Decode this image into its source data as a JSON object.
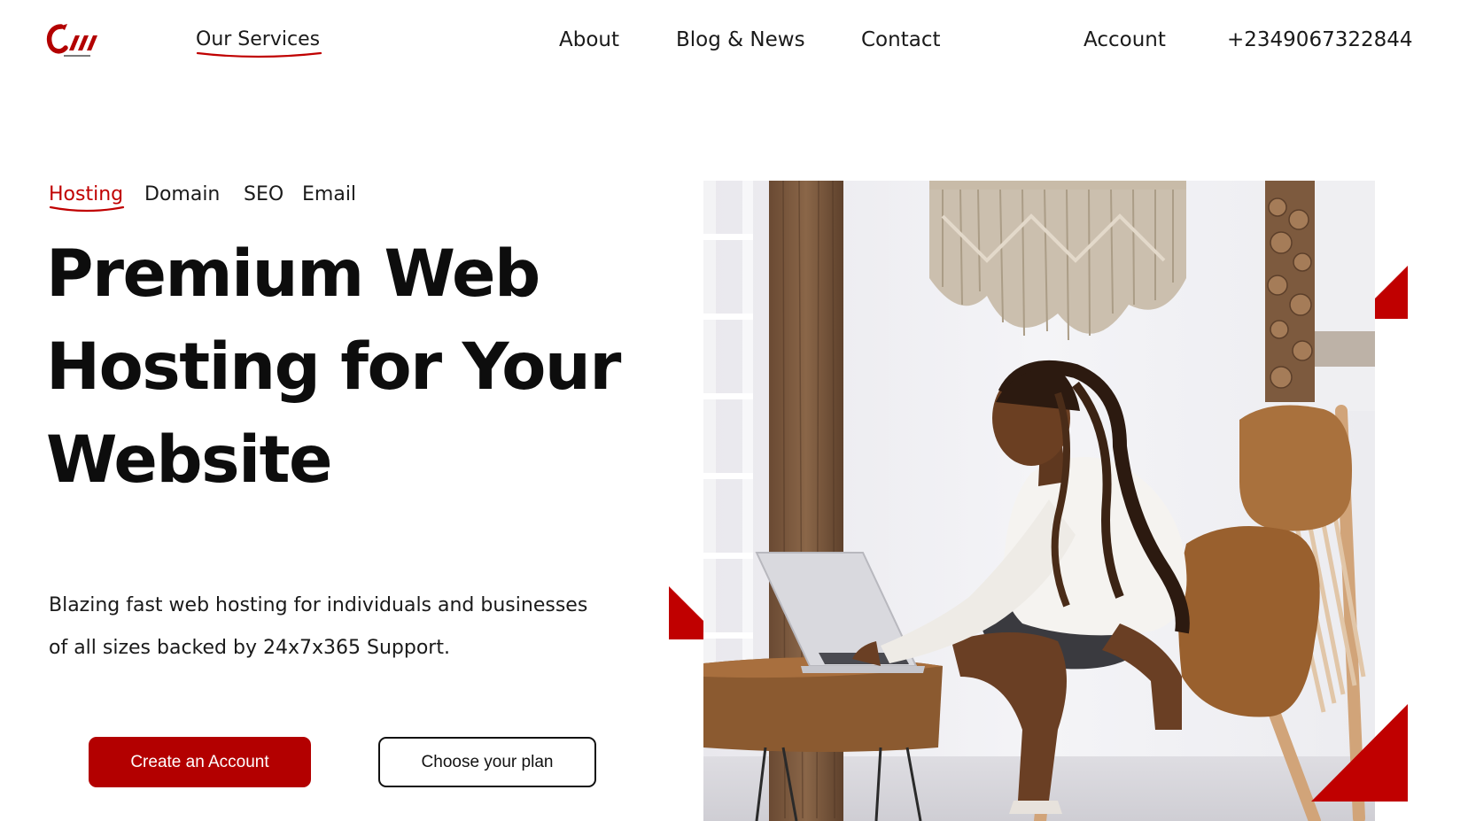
{
  "header": {
    "logo_icon": "brand-logo-icon",
    "nav": {
      "services": "Our Services",
      "about": "About",
      "blog": "Blog & News",
      "contact": "Contact",
      "account": "Account",
      "phone": "+2349067322844"
    }
  },
  "tabs": {
    "items": [
      "Hosting",
      "Domain",
      "SEO",
      "Email"
    ],
    "active": "Hosting"
  },
  "hero": {
    "title_lines": [
      "Premium Web",
      "Hosting for Your",
      "Website"
    ],
    "description_lines": [
      "Blazing fast web hosting for individuals and businesses",
      "of all sizes backed by 24x7x365 Support."
    ],
    "primary_button": "Create an Account",
    "secondary_button": "Choose your plan",
    "image_icon": "hero-photo-woman-laptop"
  },
  "colors": {
    "accent": "#b30000",
    "accent_text": "#c00000",
    "text": "#111111",
    "background": "#ffffff"
  }
}
